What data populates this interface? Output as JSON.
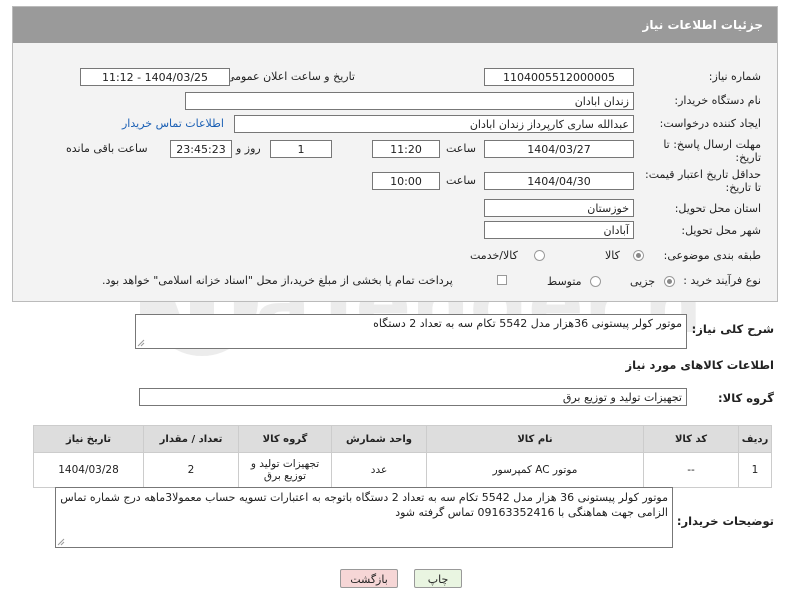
{
  "header": {
    "title": "جزئیات اطلاعات نیاز"
  },
  "fields": {
    "need_number_label": "شماره نیاز:",
    "need_number": "1104005512000005",
    "announce_label": "تاریخ و ساعت اعلان عمومی:",
    "announce_value": "1404/03/25 - 11:12",
    "buyer_org_label": "نام دستگاه خریدار:",
    "buyer_org": "زندان ابادان",
    "creator_label": "ایجاد کننده درخواست:",
    "creator": "عبدالله ساری کارپرداز زندان ابادان",
    "contact_link": "اطلاعات تماس خریدار",
    "deadline_label_1": "مهلت ارسال پاسخ: تا",
    "deadline_label_2": "تاریخ:",
    "deadline_date": "1404/03/27",
    "time_label": "ساعت",
    "deadline_time": "11:20",
    "days_value": "1",
    "day_and_label": "روز و",
    "remaining_time": "23:45:23",
    "remaining_label": "ساعت باقی مانده",
    "validity_label_1": "حداقل تاریخ اعتبار قیمت:",
    "validity_label_2": "تا تاریخ:",
    "validity_date": "1404/04/30",
    "validity_time": "10:00",
    "province_label": "استان محل تحویل:",
    "province": "خوزستان",
    "city_label": "شهر محل تحویل:",
    "city": "آبادان",
    "category_label": "طبقه بندی موضوعی:",
    "category_options": [
      "کالا",
      "کالا/خدمت"
    ],
    "process_label": "نوع فرآیند خرید :",
    "process_options": [
      "جزیی",
      "متوسط"
    ],
    "payment_note": "پرداخت تمام یا بخشی از مبلغ خرید،از محل \"اسناد خزانه اسلامی\" خواهد بود."
  },
  "description": {
    "label": "شرح کلی نیاز:",
    "text": "موتور کولر پیستونی 36هزار مدل 5542 تکام سه به تعداد 2 دستگاه"
  },
  "goods": {
    "section_title": "اطلاعات کالاهای مورد نیاز",
    "group_label": "گروه کالا:",
    "group_value": "تجهیزات تولید و توزیع برق",
    "columns": [
      "ردیف",
      "کد کالا",
      "نام کالا",
      "واحد شمارش",
      "گروه کالا",
      "تعداد / مقدار",
      "تاریخ نیاز"
    ],
    "rows": [
      {
        "row": "1",
        "code": "--",
        "name": "موتور AC کمپرسور",
        "unit": "عدد",
        "group": "تجهیزات تولید و توزیع برق",
        "qty": "2",
        "date": "1404/03/28"
      }
    ]
  },
  "buyer_notes": {
    "label": "توضیحات خریدار:",
    "text": "موتور کولر پیستونی 36 هزار مدل 5542 تکام سه به تعداد 2 دستگاه باتوجه به اعتبارات تسویه حساب معمولا3ماهه درج شماره تماس الزامی جهت هماهنگی با 09163352416 تماس گرفته شود"
  },
  "buttons": {
    "print": "چاپ",
    "back": "بازگشت"
  },
  "watermark_text": "AriaTender.net",
  "colors": {
    "title_bar": "#9a9a9a",
    "link": "#1a5fb4",
    "back_button": "#f6d6d6",
    "print_button": "#e9f5e1"
  }
}
